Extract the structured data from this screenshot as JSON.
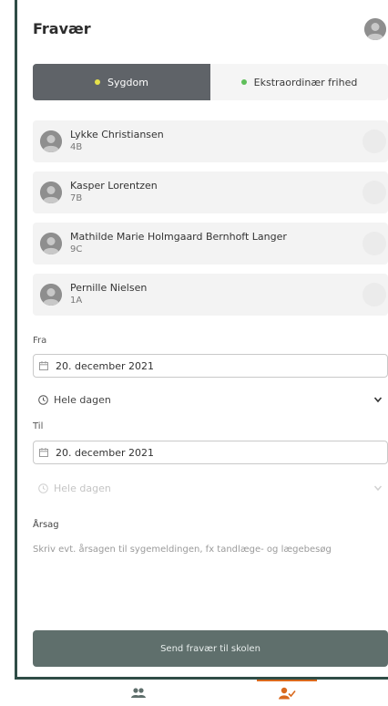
{
  "header": {
    "title": "Fravær",
    "profile_icon": "user-avatar-icon"
  },
  "segment": {
    "options": [
      {
        "label": "Sygdom",
        "dot_color": "#e6e14a",
        "active": true
      },
      {
        "label": "Ekstraordinær frihed",
        "dot_color": "#5fbf5a",
        "active": false
      }
    ]
  },
  "students": [
    {
      "name": "Lykke Christiansen",
      "class": "4B"
    },
    {
      "name": "Kasper Lorentzen",
      "class": "7B"
    },
    {
      "name": "Mathilde Marie Holmgaard Bernhoft Langer",
      "class": "9C"
    },
    {
      "name": "Pernille Nielsen",
      "class": "1A"
    }
  ],
  "from": {
    "label": "Fra",
    "date": "20. december 2021",
    "time": "Hele dagen"
  },
  "to": {
    "label": "Til",
    "date": "20. december 2021",
    "time": "Hele dagen"
  },
  "reason": {
    "label": "Årsag",
    "placeholder": "Skriv evt. årsagen til sygemeldingen, fx tandlæge- og lægebesøg"
  },
  "submit": {
    "label": "Send fravær til skolen"
  },
  "tabbar": {
    "tabs": [
      {
        "icon": "people-icon",
        "active": false
      },
      {
        "icon": "person-check-icon",
        "active": true
      }
    ],
    "accent_color": "#d9691e"
  }
}
